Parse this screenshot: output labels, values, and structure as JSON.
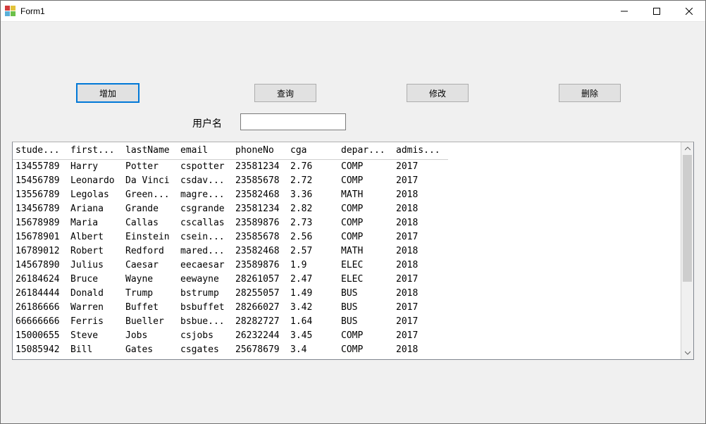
{
  "window": {
    "title": "Form1"
  },
  "buttons": {
    "add": "增加",
    "query": "查询",
    "modify": "修改",
    "delete": "删除"
  },
  "label_username": "用户名",
  "input_username": {
    "value": "",
    "placeholder": ""
  },
  "columns": {
    "student": "stude...",
    "first": "first...",
    "last": "lastName",
    "email": "email",
    "phone": "phoneNo",
    "cga": "cga",
    "dept": "depar...",
    "admis": "admis..."
  },
  "rows": [
    {
      "studentId": "13455789",
      "first": "Harry",
      "last": "Potter",
      "email": "cspotter",
      "phone": "23581234",
      "cga": "2.76",
      "dept": "COMP",
      "admis": "2017"
    },
    {
      "studentId": "15456789",
      "first": "Leonardo",
      "last": "Da Vinci",
      "email": "csdav...",
      "phone": "23585678",
      "cga": "2.72",
      "dept": "COMP",
      "admis": "2017"
    },
    {
      "studentId": "13556789",
      "first": "Legolas",
      "last": "Green...",
      "email": "magre...",
      "phone": "23582468",
      "cga": "3.36",
      "dept": "MATH",
      "admis": "2018"
    },
    {
      "studentId": "13456789",
      "first": "Ariana",
      "last": "Grande",
      "email": "csgrande",
      "phone": "23581234",
      "cga": "2.82",
      "dept": "COMP",
      "admis": "2018"
    },
    {
      "studentId": "15678989",
      "first": "Maria",
      "last": "Callas",
      "email": "cscallas",
      "phone": "23589876",
      "cga": "2.73",
      "dept": "COMP",
      "admis": "2018"
    },
    {
      "studentId": "15678901",
      "first": "Albert",
      "last": "Einstein",
      "email": "csein...",
      "phone": "23585678",
      "cga": "2.56",
      "dept": "COMP",
      "admis": "2017"
    },
    {
      "studentId": "16789012",
      "first": "Robert",
      "last": "Redford",
      "email": "mared...",
      "phone": "23582468",
      "cga": "2.57",
      "dept": "MATH",
      "admis": "2018"
    },
    {
      "studentId": "14567890",
      "first": "Julius",
      "last": "Caesar",
      "email": "eecaesar",
      "phone": "23589876",
      "cga": "1.9",
      "dept": "ELEC",
      "admis": "2018"
    },
    {
      "studentId": "26184624",
      "first": "Bruce",
      "last": "Wayne",
      "email": "eewayne",
      "phone": "28261057",
      "cga": "2.47",
      "dept": "ELEC",
      "admis": "2017"
    },
    {
      "studentId": "26184444",
      "first": "Donald",
      "last": "Trump",
      "email": "bstrump",
      "phone": "28255057",
      "cga": "1.49",
      "dept": "BUS",
      "admis": "2018"
    },
    {
      "studentId": "26186666",
      "first": "Warren",
      "last": "Buffet",
      "email": "bsbuffet",
      "phone": "28266027",
      "cga": "3.42",
      "dept": "BUS",
      "admis": "2017"
    },
    {
      "studentId": "66666666",
      "first": "Ferris",
      "last": "Bueller",
      "email": "bsbue...",
      "phone": "28282727",
      "cga": "1.64",
      "dept": "BUS",
      "admis": "2017"
    },
    {
      "studentId": "15000655",
      "first": "Steve",
      "last": "Jobs",
      "email": "csjobs",
      "phone": "26232244",
      "cga": "3.45",
      "dept": "COMP",
      "admis": "2017"
    },
    {
      "studentId": "15085942",
      "first": "Bill",
      "last": "Gates",
      "email": "csgates",
      "phone": "25678679",
      "cga": "3.4",
      "dept": "COMP",
      "admis": "2018"
    }
  ]
}
